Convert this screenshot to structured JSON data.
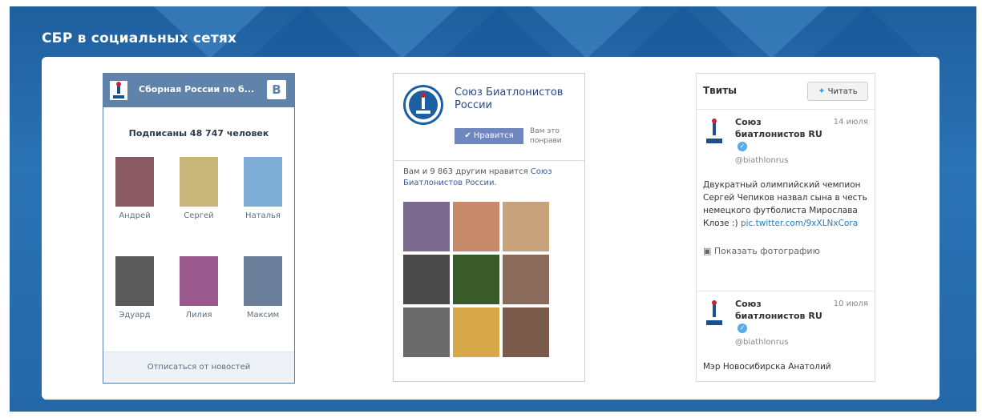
{
  "section_title": "СБР в социальных сетях",
  "vk": {
    "title": "Сборная России по б...",
    "badge": "В",
    "subscribers": "Подписаны 48 747 человек",
    "members": [
      {
        "name": "Андрей",
        "color": "#8a5a62"
      },
      {
        "name": "Сергей",
        "color": "#c8b57a"
      },
      {
        "name": "Наталья",
        "color": "#7eaed6"
      },
      {
        "name": "Эдуард",
        "color": "#5a5a5a"
      },
      {
        "name": "Лилия",
        "color": "#9a5a8e"
      },
      {
        "name": "Максим",
        "color": "#6c7f9a"
      }
    ],
    "unsubscribe": "Отписаться от новостей"
  },
  "fb": {
    "name": "Союз Биатлонистов России",
    "like_button": "✔ Нравится",
    "meta_line1": "Вам это",
    "meta_line2": "понрави",
    "friends_text": "Вам и 9 863 другим нравится ",
    "friends_link": "Союз Биатлонистов России.",
    "photos": [
      "#7a6a8e",
      "#c88a6a",
      "#c8a27a",
      "#4a4a4a",
      "#3a5a2a",
      "#8a6a5a",
      "#6a6a6a",
      "#d6a84a",
      "#7a5a4a"
    ]
  },
  "twitter": {
    "title": "Твиты",
    "read_button": "Читать",
    "tweets": [
      {
        "user": "Союз биатлонистов RU",
        "date": "14 июля",
        "handle": "@biathlonrus",
        "text": "Двукратный олимпийский чемпион Сергей Чепиков назвал сына в честь немецкого футболиста Мирослава Клозе :) ",
        "link": "pic.twitter.com/9xXLNxCora",
        "photo_link": "Показать фотографию"
      },
      {
        "user": "Союз биатлонистов RU",
        "date": "10 июля",
        "handle": "@biathlonrus",
        "text": "Мэр Новосибирска Анатолий"
      }
    ]
  }
}
